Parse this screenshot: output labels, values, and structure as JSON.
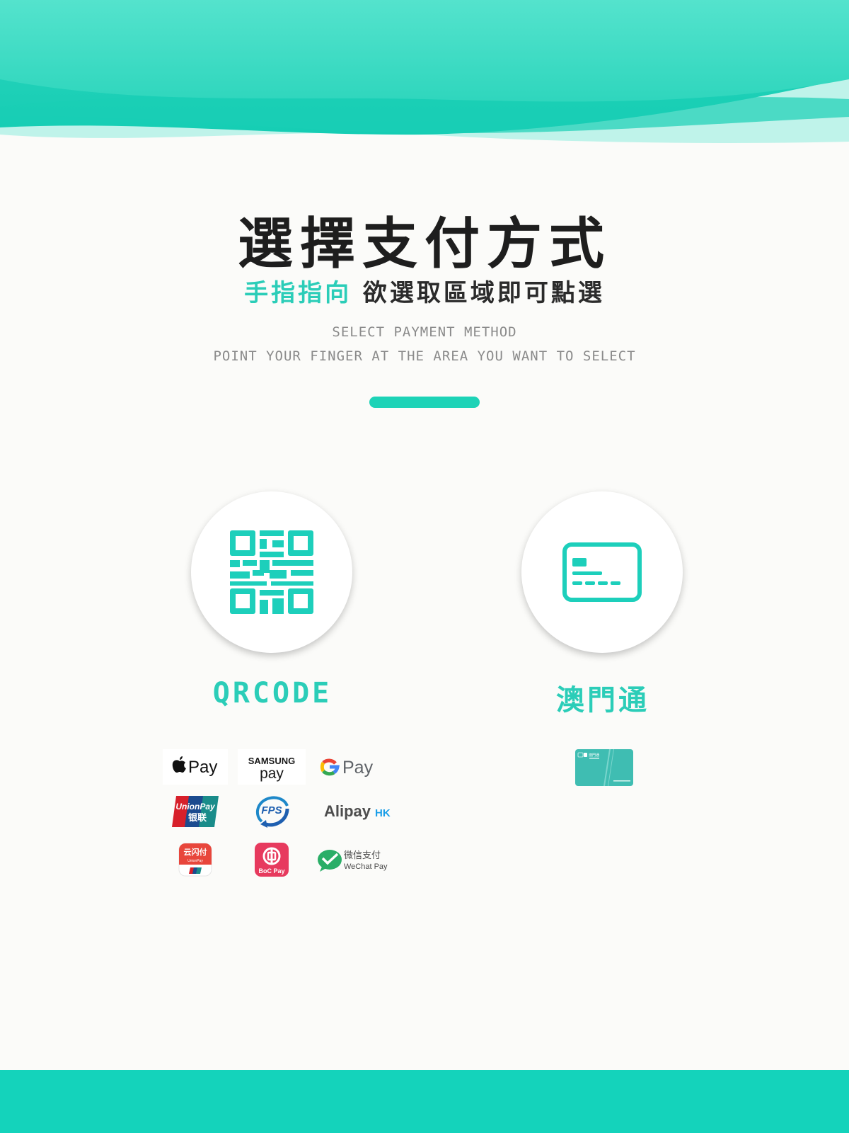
{
  "header": {
    "title": "選擇支付方式",
    "subtitle_highlight": "手指指向",
    "subtitle_rest": "欲選取區域即可點選",
    "en_line1": "SELECT PAYMENT METHOD",
    "en_line2": "POINT YOUR FINGER AT THE AREA YOU WANT TO SELECT"
  },
  "colors": {
    "accent": "#2bcdb8",
    "accent_bar": "#1dd3b7",
    "wave_top": "#54e3cd",
    "footer": "#14d3bb",
    "title_text": "#1e1e1e",
    "muted_text": "#8a8a8a"
  },
  "methods": [
    {
      "id": "qrcode",
      "label": "QRCODE",
      "icon": "qr-code-icon",
      "logos": [
        {
          "name": "apple-pay-logo",
          "text": "Pay"
        },
        {
          "name": "samsung-pay-logo",
          "text1": "SAMSUNG",
          "text2": "pay"
        },
        {
          "name": "google-pay-logo",
          "text": "Pay"
        },
        {
          "name": "unionpay-logo",
          "text1": "UnionPay",
          "text2": "银联"
        },
        {
          "name": "fps-logo",
          "text": "FPS"
        },
        {
          "name": "alipay-hk-logo",
          "text1": "Alipay",
          "text2": "HK"
        },
        {
          "name": "cloud-quickpass-logo",
          "text1": "云闪付",
          "text2": "UnionPay"
        },
        {
          "name": "boc-pay-logo",
          "text": "BoC Pay"
        },
        {
          "name": "wechat-pay-logo",
          "text1": "微信支付",
          "text2": "WeChat Pay"
        }
      ]
    },
    {
      "id": "macau-pass",
      "label": "澳門通",
      "icon": "card-icon",
      "logos": [
        {
          "name": "macau-pass-card-logo",
          "text": "澳門通"
        }
      ]
    }
  ]
}
